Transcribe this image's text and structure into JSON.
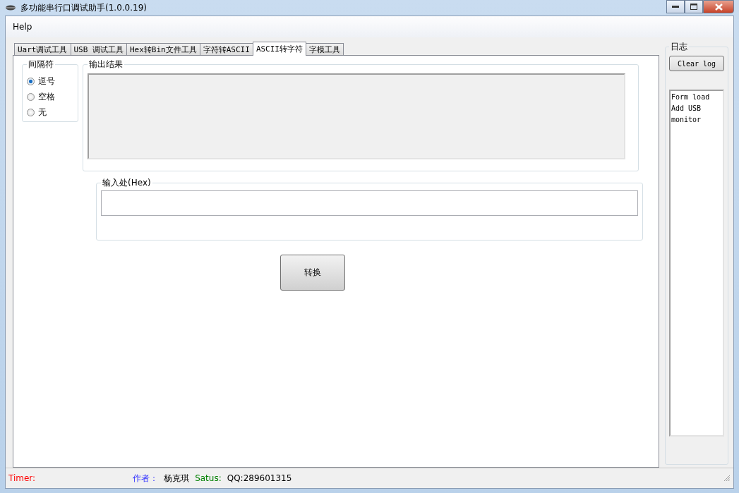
{
  "window": {
    "title": "多功能串行口调试助手(1.0.0.19)"
  },
  "menu": [
    "Help"
  ],
  "tabs": [
    {
      "label": "Uart调试工具",
      "selected": false
    },
    {
      "label": "USB 调试工具",
      "selected": false
    },
    {
      "label": "Hex转Bin文件工具",
      "selected": false
    },
    {
      "label": "字符转ASCII",
      "selected": false
    },
    {
      "label": "ASCII转字符",
      "selected": true
    },
    {
      "label": "字模工具",
      "selected": false
    }
  ],
  "separator_group": {
    "title": "间隔符",
    "options": [
      {
        "label": "逗号",
        "selected": true
      },
      {
        "label": "空格",
        "selected": false
      },
      {
        "label": "无",
        "selected": false
      }
    ]
  },
  "output_group": {
    "title": "输出结果"
  },
  "input_group": {
    "title": "输入处(Hex)"
  },
  "convert_button": "转换",
  "log_group": {
    "title": "日志",
    "clear_button": "Clear log",
    "lines": [
      "Form load",
      "Add USB",
      "monitor"
    ]
  },
  "status_bar": [
    {
      "text": "Timer:",
      "color": "#ff0000"
    },
    {
      "text": "作者：",
      "color": "#3333ff"
    },
    {
      "text": "杨克琪"
    },
    {
      "text": "Satus:",
      "color": "#008000"
    },
    {
      "text": "QQ:289601315"
    }
  ]
}
